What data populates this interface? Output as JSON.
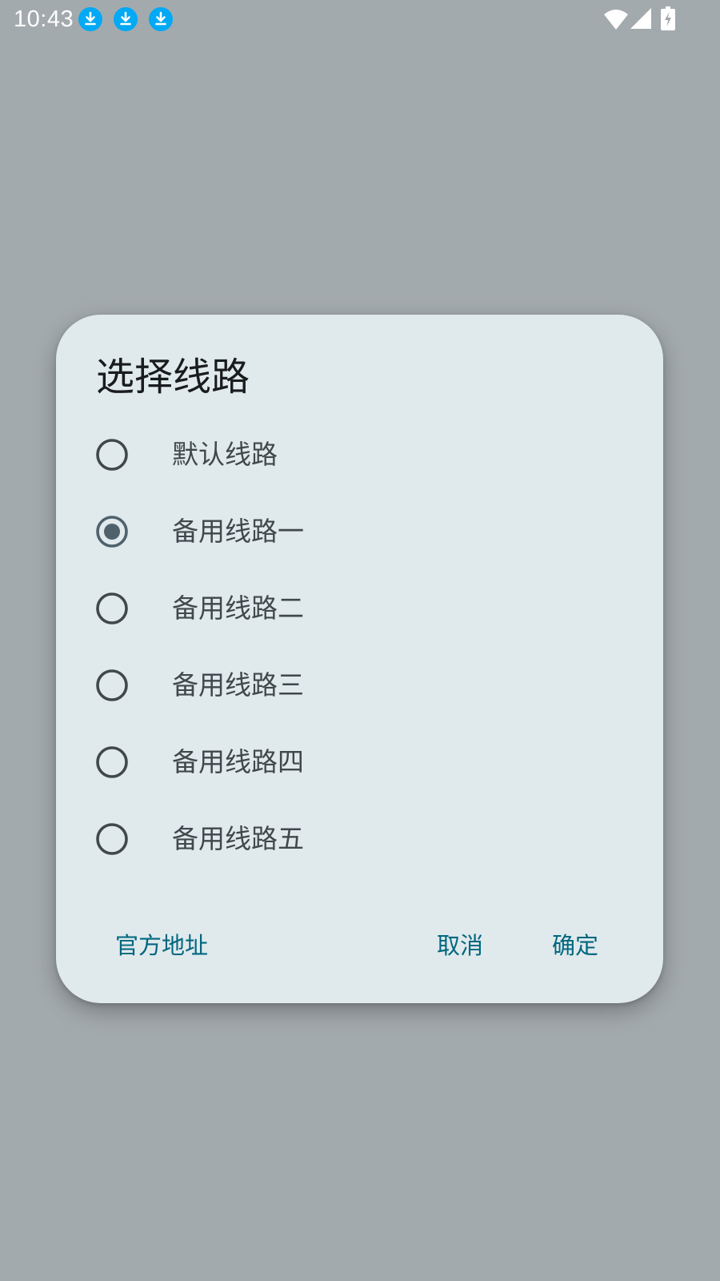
{
  "status_bar": {
    "time": "10:43",
    "icons": [
      "download-icon",
      "download-icon",
      "download-icon",
      "wifi-icon",
      "cellular-signal-icon",
      "battery-charging-icon"
    ],
    "download_icon_color": "#03a9f4"
  },
  "dialog": {
    "title": "选择线路",
    "options": [
      {
        "label": "默认线路",
        "selected": false
      },
      {
        "label": "备用线路一",
        "selected": true
      },
      {
        "label": "备用线路二",
        "selected": false
      },
      {
        "label": "备用线路三",
        "selected": false
      },
      {
        "label": "备用线路四",
        "selected": false
      },
      {
        "label": "备用线路五",
        "selected": false
      }
    ],
    "buttons": {
      "official": "官方地址",
      "cancel": "取消",
      "confirm": "确定"
    }
  },
  "colors": {
    "scrim": "#a3aaad",
    "dialog_surface": "#e0e9ec",
    "accent": "#00677f",
    "radio_selected": "#4f616b",
    "radio_unselected": "#40484c"
  }
}
